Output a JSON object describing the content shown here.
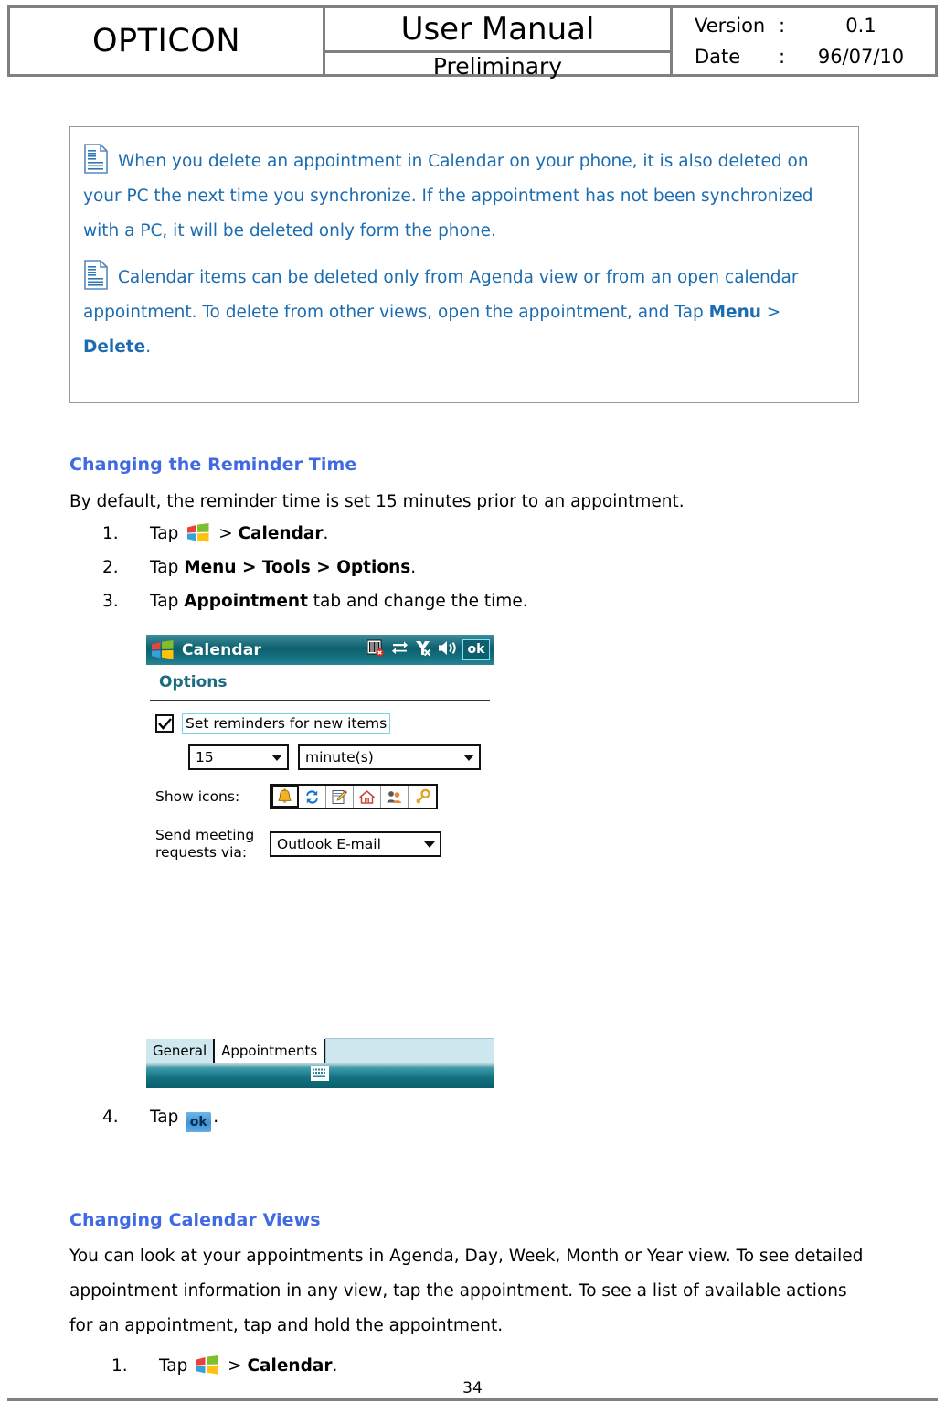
{
  "header": {
    "logo": "OPTICON",
    "title_main": "User Manual",
    "title_sub": "Preliminary",
    "meta": [
      {
        "label": "Version",
        "colon": ":",
        "value": "0.1"
      },
      {
        "label": "Date",
        "colon": ":",
        "value": "96/07/10"
      }
    ]
  },
  "note_box": {
    "icon_name": "note-document-icon",
    "paragraphs": [
      {
        "text": "When you delete an appointment in Calendar on your phone, it is also deleted on your PC the next time you synchronize. If the appointment has not been synchronized with a PC, it will be deleted only form the phone."
      },
      {
        "lead": "Calendar items can be deleted only from Agenda view or from an open calendar appointment. To delete from other views, open the appointment, and Tap ",
        "bold1": "Menu",
        "sep": " > ",
        "bold2": "Delete",
        "tail": "."
      }
    ]
  },
  "section1": {
    "heading": "Changing the Reminder Time",
    "intro": "By default, the reminder time is set 15 minutes prior to an appointment.",
    "steps": [
      {
        "num": "1.",
        "pre": "Tap ",
        "icon": "windows-start-icon",
        "mid": " > ",
        "bold": "Calendar",
        "tail": "."
      },
      {
        "num": "2.",
        "pre": "Tap ",
        "bold": "Menu > Tools > Options",
        "tail": "."
      },
      {
        "num": "3.",
        "pre": "Tap ",
        "bold": "Appointment",
        "tail": " tab and change the time."
      }
    ],
    "step4": {
      "num": "4.",
      "pre": "Tap ",
      "chip": "ok",
      "tail": "."
    }
  },
  "pda_screenshot": {
    "titlebar": {
      "app_title": "Calendar",
      "start_icon": "windows-start-icon",
      "tray_icons": [
        "barcode-scanner-disabled-icon",
        "connectivity-icon",
        "no-signal-icon",
        "volume-icon"
      ],
      "ok_button": "ok"
    },
    "page_title": "Options",
    "checkbox": {
      "label": "Set reminders for new items",
      "checked": true
    },
    "reminder_value": "15",
    "reminder_unit": "minute(s)",
    "show_icons_label": "Show icons:",
    "show_icons": [
      "bell-icon",
      "recurrence-icon",
      "note-icon",
      "home-icon",
      "people-icon",
      "key-icon"
    ],
    "send_meeting_label": "Send meeting\nrequests via:",
    "send_meeting_label_line1": "Send meeting",
    "send_meeting_label_line2": "requests via:",
    "send_meeting_value": "Outlook E-mail",
    "tabs": [
      {
        "label": "General",
        "active": false
      },
      {
        "label": "Appointments",
        "active": true
      }
    ],
    "soft_bar_icon": "keyboard-sip-icon"
  },
  "section2": {
    "heading": "Changing Calendar Views",
    "body": "You can look at your appointments in Agenda, Day, Week, Month or Year view. To see detailed appointment information in any view, tap the appointment. To see a list of available actions for an appointment, tap and hold the appointment.",
    "steps": [
      {
        "num": "1.",
        "pre": "Tap ",
        "icon": "windows-start-icon",
        "mid": " > ",
        "bold": "Calendar",
        "tail": "."
      }
    ]
  },
  "footer": {
    "page_number": "34"
  },
  "colors": {
    "heading_blue": "#4169E1",
    "note_blue": "#1B6CB0",
    "header_border": "#808080",
    "pda_titlebar": "#0E5F6E",
    "pda_page_title": "#1C6B80"
  }
}
